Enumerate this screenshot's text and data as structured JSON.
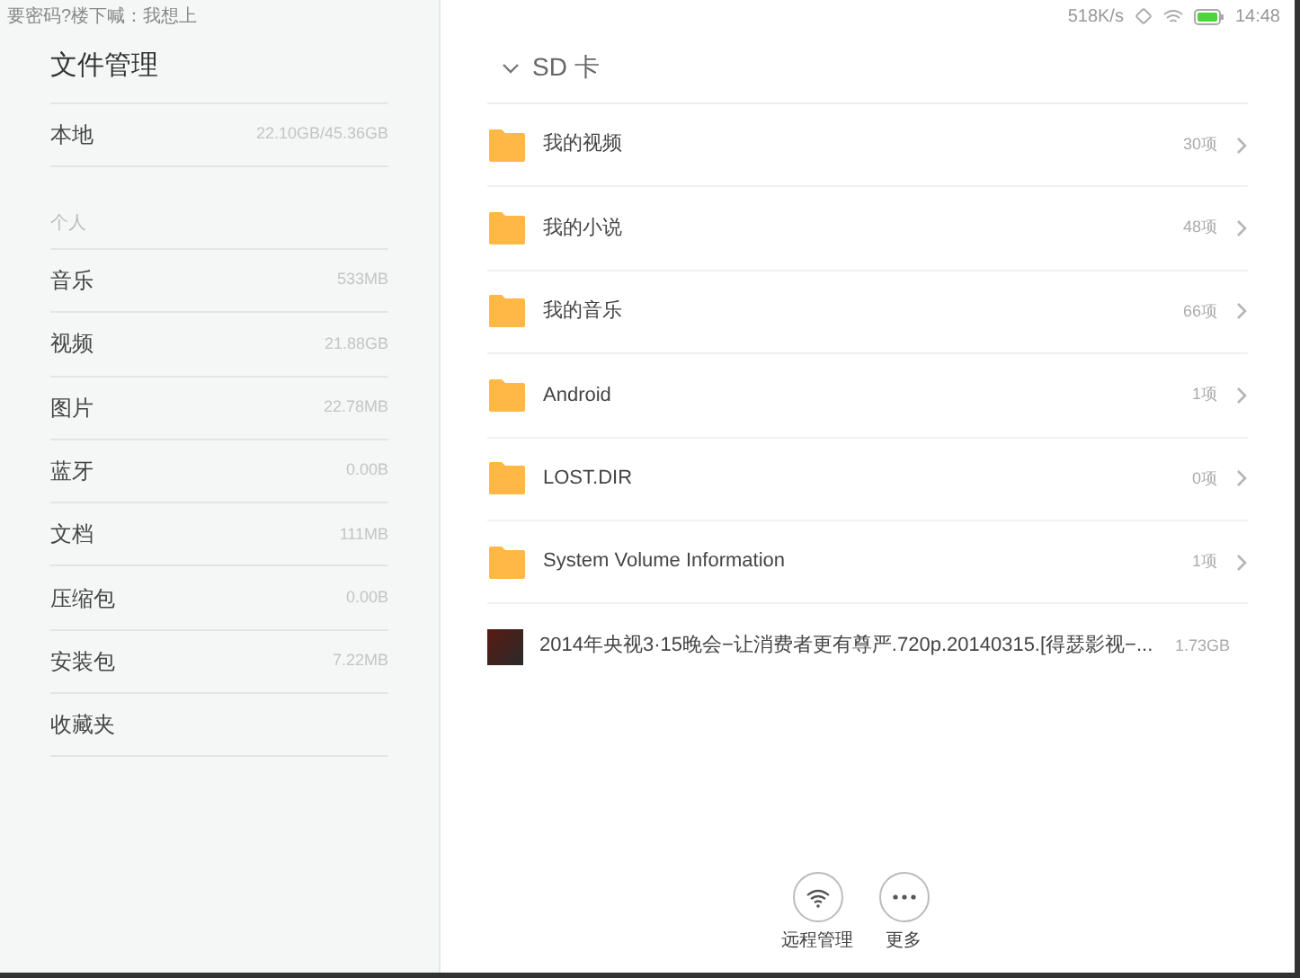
{
  "status_bar": {
    "notice": "要密码?楼下喊：我想上",
    "speed": "518K/s",
    "time": "14:48"
  },
  "sidebar": {
    "title": "文件管理",
    "storage": {
      "label": "本地",
      "value": "22.10GB/45.36GB"
    },
    "section_label": "个人",
    "items": [
      {
        "label": "音乐",
        "size": "533MB"
      },
      {
        "label": "视频",
        "size": "21.88GB"
      },
      {
        "label": "图片",
        "size": "22.78MB"
      },
      {
        "label": "蓝牙",
        "size": "0.00B"
      },
      {
        "label": "文档",
        "size": "111MB"
      },
      {
        "label": "压缩包",
        "size": "0.00B"
      },
      {
        "label": "安装包",
        "size": "7.22MB"
      },
      {
        "label": "收藏夹"
      }
    ]
  },
  "volume": {
    "title": "SD 卡",
    "expanded": true
  },
  "entries": [
    {
      "kind": "folder",
      "name": "我的视频",
      "info": "30项"
    },
    {
      "kind": "folder",
      "name": "我的小说",
      "info": "48项"
    },
    {
      "kind": "folder",
      "name": "我的音乐",
      "info": "66项"
    },
    {
      "kind": "folder",
      "name": "Android",
      "info": "1项"
    },
    {
      "kind": "folder",
      "name": "LOST.DIR",
      "info": "0项"
    },
    {
      "kind": "folder",
      "name": "System Volume Information",
      "info": "1项"
    },
    {
      "kind": "file",
      "name": "2014年央视3·15晚会−让消费者更有尊严.720p.20140315.[得瑟影视−...",
      "info": "1.73GB"
    }
  ],
  "actions": [
    {
      "kind": "remote",
      "label": "远程管理"
    },
    {
      "kind": "more",
      "label": "更多"
    }
  ]
}
